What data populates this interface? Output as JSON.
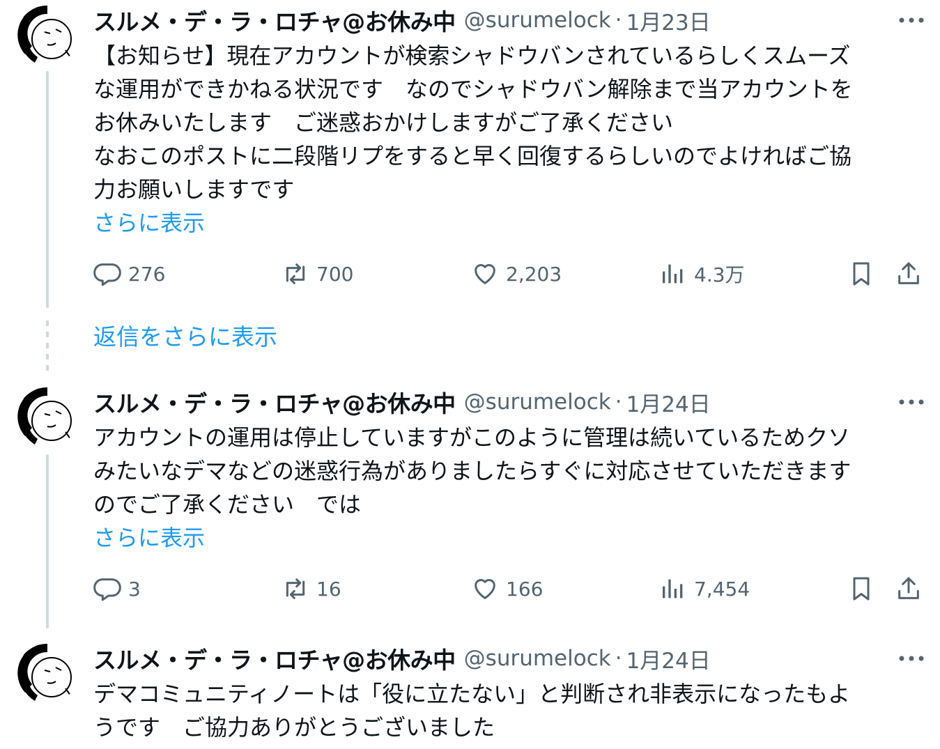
{
  "show_more_replies": "返信をさらに表示",
  "tweets": [
    {
      "name": "スルメ・デ・ラ・ロチャ@お休み中",
      "handle": "@surumelock",
      "separator": "·",
      "date": "1月23日",
      "lines": [
        "【お知らせ】現在アカウントが検索シャドウバンされているらしくスムーズ",
        "な運用ができかねる状況です　なのでシャドウバン解除まで当アカウントを",
        "お休みいたします　ご迷惑おかけしますがご了承ください",
        "なおこのポストに二段階リプをすると早く回復するらしいのでよければご協",
        "力お願いしますです"
      ],
      "show_more": "さらに表示",
      "replies": "276",
      "reposts": "700",
      "likes": "2,203",
      "views": "4.3万"
    },
    {
      "name": "スルメ・デ・ラ・ロチャ@お休み中",
      "handle": "@surumelock",
      "separator": "·",
      "date": "1月24日",
      "lines": [
        "アカウントの運用は停止していますがこのように管理は続いているためクソ",
        "みたいなデマなどの迷惑行為がありましたらすぐに対応させていただきます",
        "のでご了承ください　では"
      ],
      "show_more": "さらに表示",
      "replies": "3",
      "reposts": "16",
      "likes": "166",
      "views": "7,454"
    },
    {
      "name": "スルメ・デ・ラ・ロチャ@お休み中",
      "handle": "@surumelock",
      "separator": "·",
      "date": "1月24日",
      "lines": [
        "デマコミュニティノートは「役に立たない」と判断され非表示になったもよ",
        "うです　ご協力ありがとうございました"
      ]
    }
  ],
  "icons": [
    "avatar",
    "more-icon",
    "reply-icon",
    "repost-icon",
    "like-icon",
    "views-icon",
    "bookmark-icon",
    "share-icon"
  ],
  "colors": {
    "link": "#1d9bf0",
    "secondary": "#536471",
    "text": "#0f1419",
    "thread_line": "#cfd9de"
  }
}
